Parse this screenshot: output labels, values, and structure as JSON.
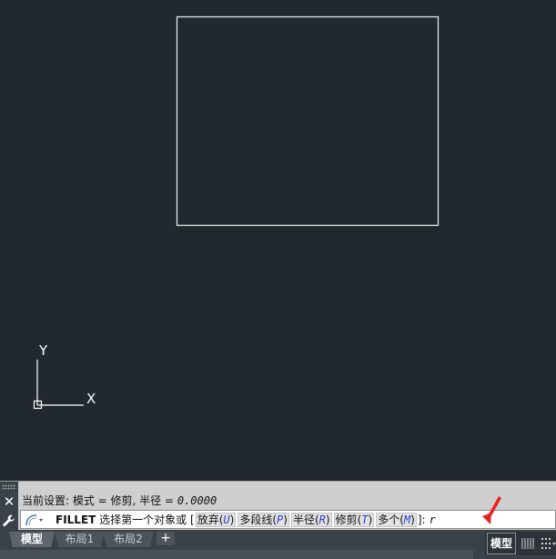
{
  "canvas": {
    "ucs": {
      "y_label": "Y",
      "x_label": "X"
    }
  },
  "command": {
    "history": {
      "prefix": "当前设置: 模式 = 修剪, 半径 = ",
      "value": "0.0000"
    },
    "prompt": {
      "command_name": "FILLET",
      "text": "选择第一个对象或",
      "bracket_open": "[",
      "options": [
        {
          "label": "放弃",
          "key": "U"
        },
        {
          "label": "多段线",
          "key": "P"
        },
        {
          "label": "半径",
          "key": "R"
        },
        {
          "label": "修剪",
          "key": "T"
        },
        {
          "label": "多个",
          "key": "M"
        }
      ],
      "bracket_close": "]:",
      "typed": "r"
    }
  },
  "layout_tabs": [
    {
      "label": "模型",
      "active": true
    },
    {
      "label": "布局1",
      "active": false
    },
    {
      "label": "布局2",
      "active": false
    }
  ],
  "add_tab": "+",
  "status": {
    "model_label": "模型"
  },
  "colors": {
    "canvas_bg": "#212830",
    "rectangle_stroke": "#f2f2f2",
    "annotation_arrow": "#e8231e",
    "option_key": "#2a3fd0"
  },
  "icons": [
    "close-icon",
    "wrench-icon",
    "fillet-command-icon",
    "grid-icon",
    "snap-icon"
  ]
}
